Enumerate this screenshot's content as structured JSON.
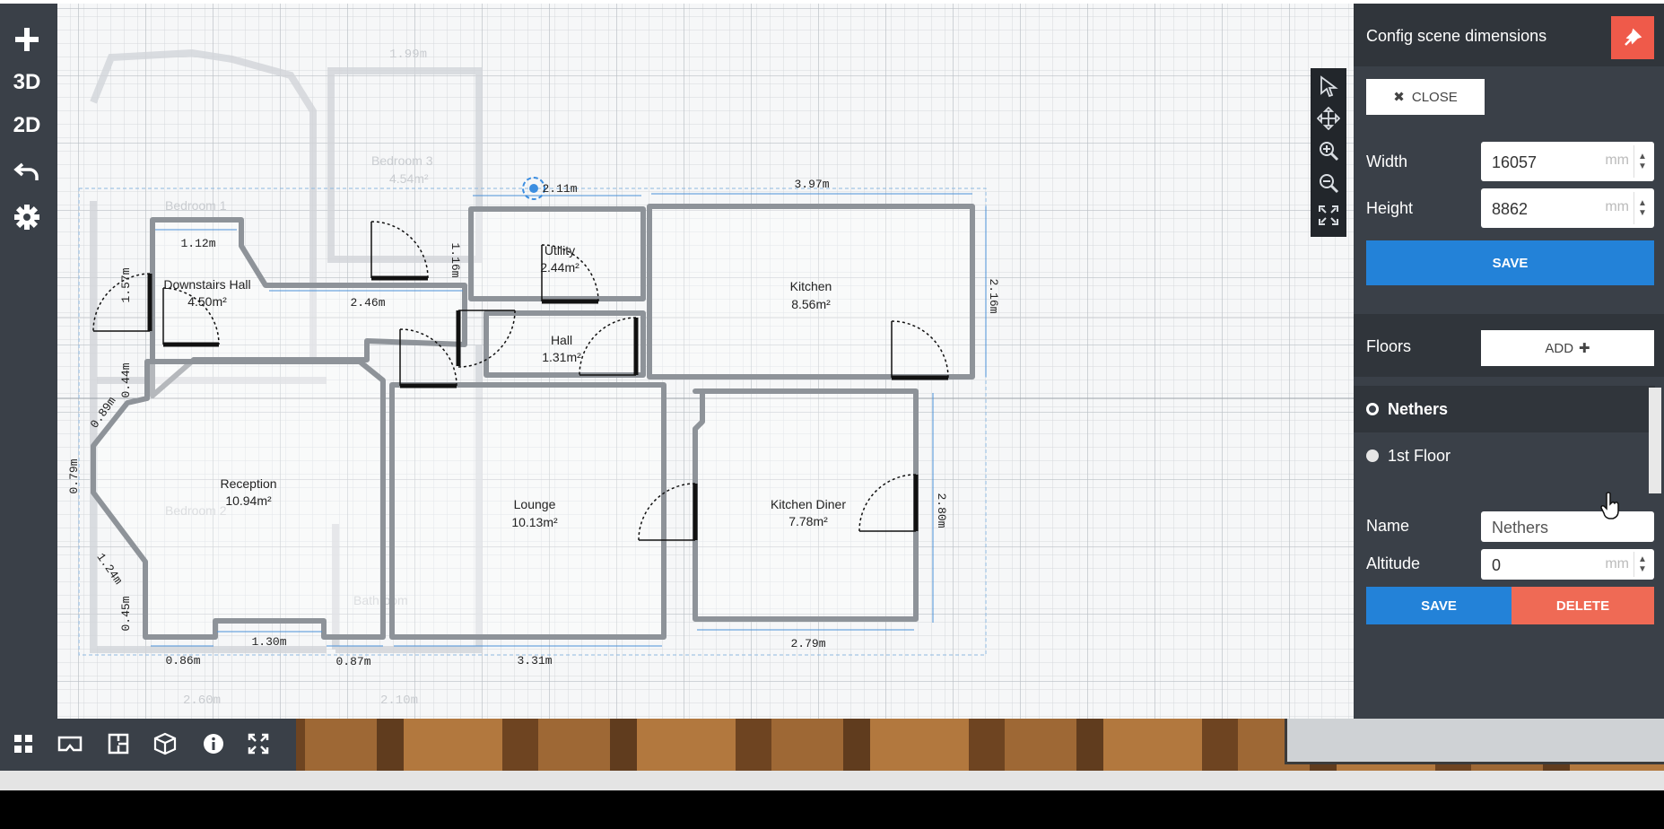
{
  "left_toolbar": {
    "add_icon": "plus-icon",
    "view3d_label": "3D",
    "view2d_label": "2D",
    "undo_icon": "undo-icon",
    "settings_icon": "gear-icon"
  },
  "canvas": {
    "rooms": [
      {
        "name": "Downstairs Hall",
        "area": "4.50m²"
      },
      {
        "name": "Utility",
        "area": "2.44m²"
      },
      {
        "name": "Kitchen",
        "area": "8.56m²"
      },
      {
        "name": "Hall",
        "area": "1.31m²"
      },
      {
        "name": "Reception",
        "area": "10.94m²"
      },
      {
        "name": "Lounge",
        "area": "10.13m²"
      },
      {
        "name": "Kitchen Diner",
        "area": "7.78m²"
      }
    ],
    "dimensions": [
      "2.11m",
      "3.97m",
      "1.12m",
      "1.57m",
      "1.16m",
      "2.46m",
      "2.16m",
      "0.44m",
      "0.89m",
      "0.79m",
      "1.24m",
      "0.45m",
      "1.30m",
      "0.86m",
      "0.87m",
      "3.31m",
      "2.79m",
      "2.80m"
    ],
    "ghost_labels": [
      "Bedroom 1",
      "Bedroom 3",
      "4.54m²",
      "Bedroom 2",
      "Bathroom",
      "1.99m",
      "2.60m",
      "2.10m"
    ]
  },
  "mini_tools": [
    "select-arrow-icon",
    "pan-move-icon",
    "zoom-in-icon",
    "zoom-out-icon",
    "fit-screen-icon"
  ],
  "bottom_bar": [
    "grid-apps-icon",
    "vr-headset-icon",
    "floorplan-icon",
    "cube-3d-icon",
    "info-icon",
    "fullscreen-icon"
  ],
  "panel": {
    "title": "Config scene dimensions",
    "close_label": "CLOSE",
    "width_label": "Width",
    "width_value": "16057",
    "width_unit": "mm",
    "height_label": "Height",
    "height_value": "8862",
    "height_unit": "mm",
    "save_label": "SAVE",
    "floors_label": "Floors",
    "add_label": "ADD",
    "floors": [
      {
        "label": "Nethers",
        "selected": true
      },
      {
        "label": "1st Floor",
        "selected": false
      }
    ],
    "name_label": "Name",
    "name_value": "Nethers",
    "altitude_label": "Altitude",
    "altitude_value": "0",
    "altitude_unit": "mm",
    "save2_label": "SAVE",
    "delete_label": "DELETE"
  },
  "colors": {
    "accent_blue": "#2382d8",
    "danger": "#ef6a55",
    "panel_bg": "#3a4048"
  }
}
